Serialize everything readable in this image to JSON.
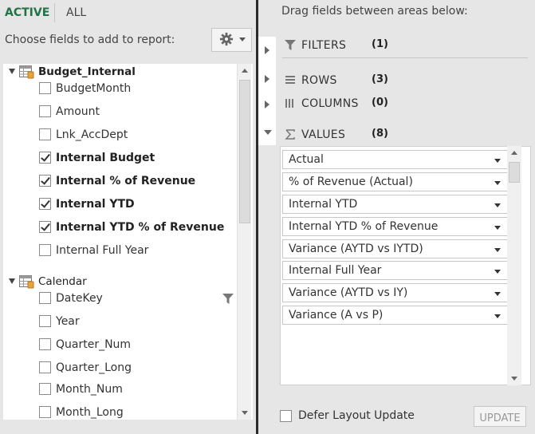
{
  "tabs": {
    "active": "ACTIVE",
    "all": "ALL"
  },
  "left": {
    "choose_label": "Choose fields to add to report:"
  },
  "tables": [
    {
      "name": "Budget_Internal",
      "fields": [
        {
          "label": "BudgetMonth",
          "checked": false
        },
        {
          "label": "Amount",
          "checked": false
        },
        {
          "label": "Lnk_AccDept",
          "checked": false
        },
        {
          "label": "Internal Budget",
          "checked": true
        },
        {
          "label": "Internal % of Revenue",
          "checked": true
        },
        {
          "label": "Internal YTD",
          "checked": true
        },
        {
          "label": "Internal YTD % of Revenue",
          "checked": true
        },
        {
          "label": "Internal Full Year",
          "checked": false
        }
      ]
    },
    {
      "name": "Calendar",
      "fields": [
        {
          "label": "DateKey",
          "checked": false
        },
        {
          "label": "Year",
          "checked": false
        },
        {
          "label": "Quarter_Num",
          "checked": false
        },
        {
          "label": "Quarter_Long",
          "checked": false
        },
        {
          "label": "Month_Num",
          "checked": false
        },
        {
          "label": "Month_Long",
          "checked": false
        }
      ]
    }
  ],
  "right": {
    "drag_label": "Drag fields between areas below:",
    "areas": {
      "filters": {
        "label": "FILTERS",
        "count": "(1)"
      },
      "rows": {
        "label": "ROWS",
        "count": "(3)"
      },
      "columns": {
        "label": "COLUMNS",
        "count": "(0)"
      },
      "values": {
        "label": "VALUES",
        "count": "(8)"
      }
    },
    "values": [
      "Actual",
      "% of Revenue (Actual)",
      "Internal YTD",
      "Internal YTD % of Revenue",
      "Variance (AYTD vs IYTD)",
      "Internal Full Year",
      "Variance (AYTD vs IY)",
      "Variance (A vs P)"
    ],
    "defer_label": "Defer Layout Update",
    "update_label": "UPDATE"
  },
  "icons": {
    "settings": "gear-icon",
    "table": "table-icon",
    "filter": "filter-icon",
    "rows": "rows-icon",
    "columns": "columns-icon",
    "sigma": "sigma-icon"
  },
  "colors": {
    "active_tab": "#217346"
  }
}
